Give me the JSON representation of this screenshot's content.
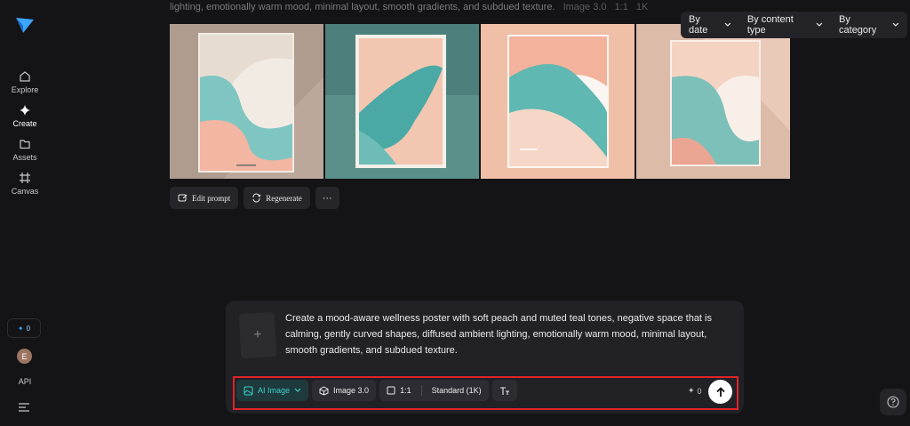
{
  "sidebar": {
    "items": [
      {
        "label": "Explore",
        "icon": "home-icon"
      },
      {
        "label": "Create",
        "icon": "sparkle-icon"
      },
      {
        "label": "Assets",
        "icon": "folder-icon"
      },
      {
        "label": "Canvas",
        "icon": "canvas-icon"
      }
    ],
    "credits": "0",
    "avatar_initial": "E",
    "api_label": "API"
  },
  "result": {
    "caption": "lighting, emotionally warm mood, minimal layout, smooth gradients, and subdued texture.",
    "model": "Image 3.0",
    "ratio": "1:1",
    "resolution": "1K",
    "actions": {
      "edit_prompt": "Edit prompt",
      "regenerate": "Regenerate",
      "more": "···"
    }
  },
  "filters": {
    "by_date": "By date",
    "by_content_type": "By content type",
    "by_category": "By category"
  },
  "composer": {
    "prompt": "Create a mood-aware wellness poster with soft peach and muted teal tones, negative space that is calming, gently curved shapes, diffused ambient lighting, emotionally warm mood, minimal layout, smooth gradients, and subdued texture.",
    "upload_glyph": "+",
    "mode": "AI Image",
    "model": "Image 3.0",
    "ratio": "1:1",
    "quality": "Standard (1K)",
    "cost": "0"
  },
  "colors": {
    "accent_teal": "#3fd0c9",
    "highlight_red": "#e3222b",
    "background": "#141416"
  }
}
